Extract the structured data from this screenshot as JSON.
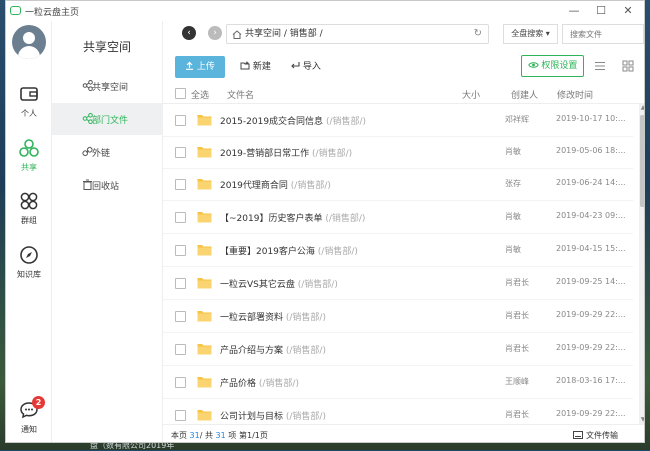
{
  "window": {
    "app_title": "一粒云盘主页",
    "controls": {
      "minimize": "—",
      "maximize": "☐",
      "close": "✕"
    }
  },
  "desktop": {
    "caption": "盘（数有限公司2019年"
  },
  "rail": {
    "items": [
      {
        "label": "个人",
        "icon": "wallet-icon"
      },
      {
        "label": "共享",
        "icon": "share-circles-icon",
        "active": true
      },
      {
        "label": "群组",
        "icon": "group-icon"
      },
      {
        "label": "知识库",
        "icon": "compass-icon"
      },
      {
        "label": "通知",
        "icon": "chat-bubble-icon",
        "badge": "2"
      }
    ]
  },
  "subnav": {
    "title": "共享空间",
    "items": [
      {
        "label": "共享空间",
        "icon": "share-icon"
      },
      {
        "label": "部门文件",
        "icon": "share-icon",
        "active": true
      },
      {
        "label": "外链",
        "icon": "link-icon"
      },
      {
        "label": "回收站",
        "icon": "trash-icon"
      }
    ]
  },
  "address": {
    "back": "‹",
    "forward": "›",
    "path": "共享空间 /  销售部 /",
    "refresh": "↻"
  },
  "search": {
    "scope": "全盘搜索 ▾",
    "placeholder": "搜索文件"
  },
  "toolbar": {
    "upload": "上传",
    "new": "新建",
    "import": "导入",
    "permission": "权限设置"
  },
  "table": {
    "headers": {
      "select_all": "全选",
      "name": "文件名",
      "size": "大小",
      "creator": "创建人",
      "modified": "修改时间"
    },
    "rows": [
      {
        "name": "2015-2019成交合同信息",
        "path": "(/销售部/)",
        "creator": "邓祥辉",
        "modified": "2019-10-17 10:..."
      },
      {
        "name": "2019-营销部日常工作",
        "path": "(/销售部/)",
        "creator": "肖敏",
        "modified": "2019-05-06 18:..."
      },
      {
        "name": "2019代理商合同",
        "path": "(/销售部/)",
        "creator": "张存",
        "modified": "2019-06-24 14:..."
      },
      {
        "name": "【~2019】历史客户表单",
        "path": "(/销售部/)",
        "creator": "肖敏",
        "modified": "2019-04-23 09:..."
      },
      {
        "name": "【重要】2019客户公海",
        "path": "(/销售部/)",
        "creator": "肖敏",
        "modified": "2019-04-15 15:..."
      },
      {
        "name": "一粒云VS其它云盘",
        "path": "(/销售部/)",
        "creator": "肖君长",
        "modified": "2019-09-25 14:..."
      },
      {
        "name": "一粒云部署资料",
        "path": "(/销售部/)",
        "creator": "肖君长",
        "modified": "2019-09-29 22:..."
      },
      {
        "name": "产品介绍与方案",
        "path": "(/销售部/)",
        "creator": "肖君长",
        "modified": "2019-09-29 22:..."
      },
      {
        "name": "产品价格",
        "path": "(/销售部/)",
        "creator": "王顺峰",
        "modified": "2018-03-16 17:..."
      },
      {
        "name": "公司计划与目标",
        "path": "(/销售部/)",
        "creator": "肖君长",
        "modified": "2019-09-29 22:..."
      }
    ]
  },
  "footer": {
    "count_prefix": "本页",
    "count_value": "31",
    "count_mid": "/ 共",
    "count_total": "31",
    "count_suffix": "项",
    "page": "第1/1页",
    "transfer": "文件传输"
  },
  "colors": {
    "accent": "#2fb45a",
    "upload_button": "#5bb4dc",
    "folder": "#f6c342",
    "badge": "#e53935"
  }
}
